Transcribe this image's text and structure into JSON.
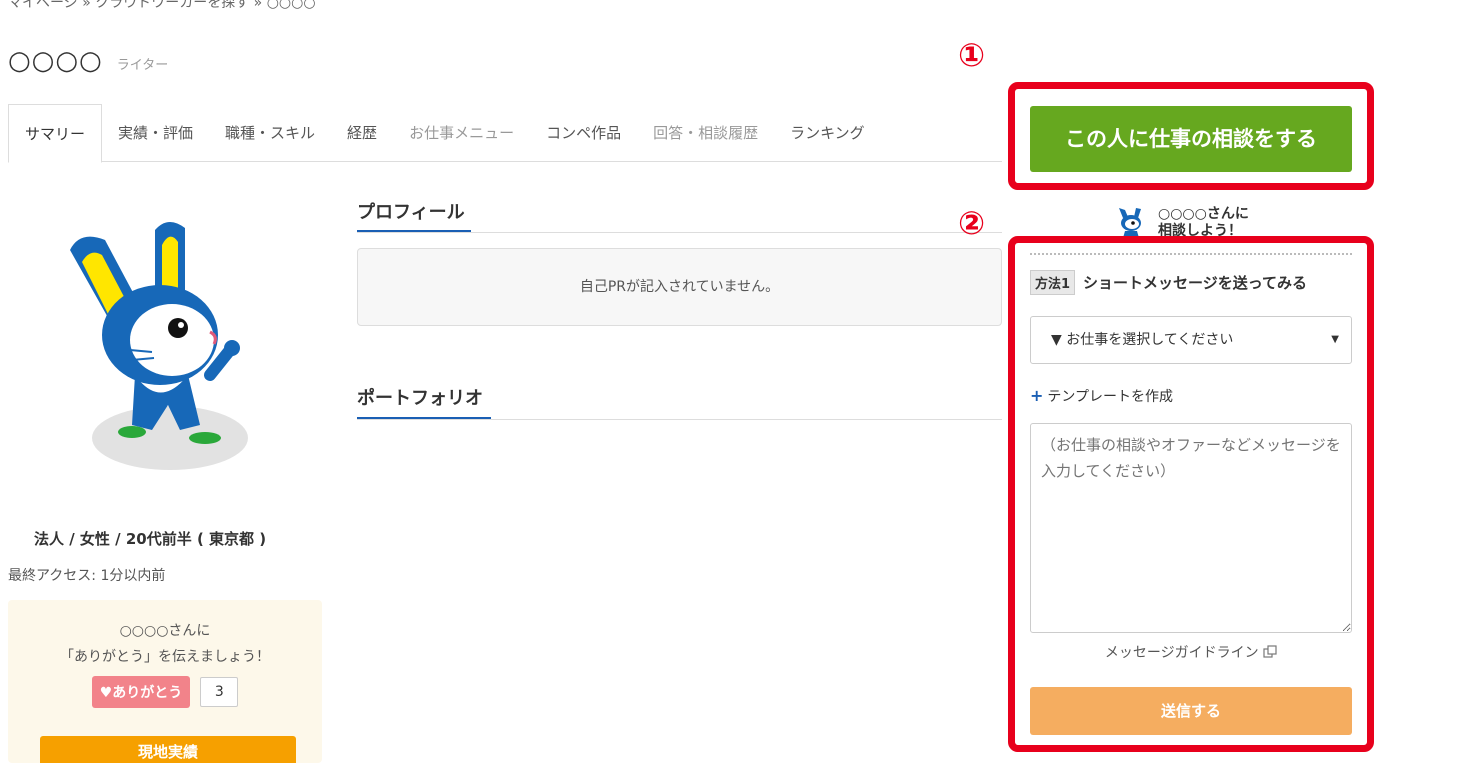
{
  "breadcrumb": {
    "mypage": "マイページ",
    "search": "クラウドワーカーを探す",
    "current": "○○○○",
    "sep": "»"
  },
  "profile": {
    "name": "○○○○",
    "role": "ライター",
    "meta": "法人 / 女性 / 20代前半 ( 東京都 )",
    "last_access": "最終アクセス: 1分以内前"
  },
  "tabs": [
    {
      "label": "サマリー"
    },
    {
      "label": "実績・評価"
    },
    {
      "label": "職種・スキル"
    },
    {
      "label": "経歴"
    },
    {
      "label": "お仕事メニュー"
    },
    {
      "label": "コンペ作品"
    },
    {
      "label": "回答・相談履歴"
    },
    {
      "label": "ランキング"
    }
  ],
  "thanks": {
    "line1": "○○○○さんに",
    "line2": "「ありがとう」を伝えましょう！",
    "button": "♥ありがとう",
    "count": "3",
    "orange_button": "現地実績"
  },
  "sections": {
    "profile_title": "プロフィール",
    "pr_empty": "自己PRが記入されていません。",
    "portfolio_title": "ポートフォリオ"
  },
  "sidebar": {
    "consult_button": "この人に仕事の相談をする",
    "consult_prompt_line1": "○○○○さんに",
    "consult_prompt_line2": "相談しよう！",
    "method_tag": "方法1",
    "method_text": "ショートメッセージを送ってみる",
    "select_value": "▼ お仕事を選択してください",
    "template_link": "テンプレートを作成",
    "textarea_placeholder": "（お仕事の相談やオファーなどメッセージを入力してください）",
    "guideline": "メッセージガイドライン",
    "send_button": "送信する"
  },
  "annotations": {
    "one": "①",
    "two": "②"
  },
  "colors": {
    "accent_green": "#66a81f",
    "highlight_red": "#e8001c",
    "send_orange": "#f5ad60",
    "link_blue": "#1a5fb4"
  }
}
